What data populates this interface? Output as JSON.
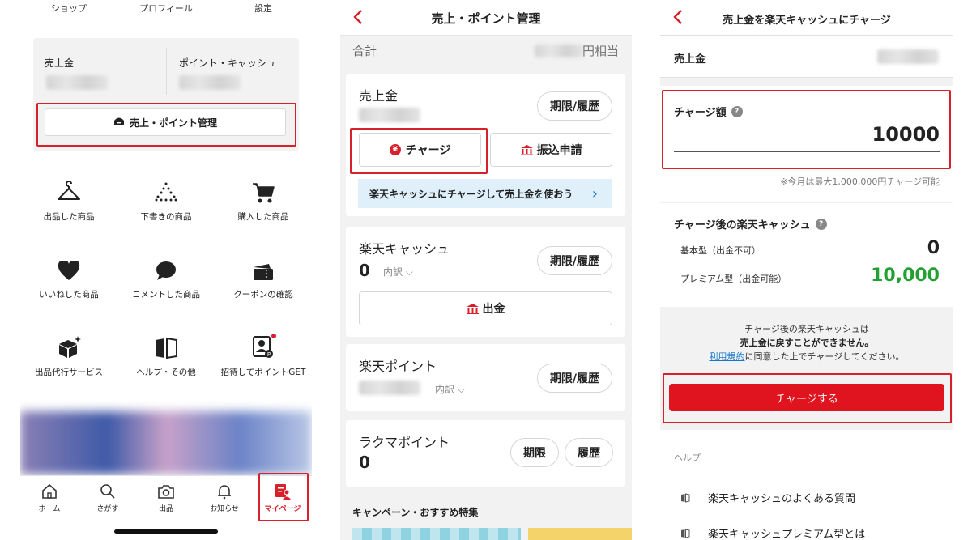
{
  "colors": {
    "accent": "#d8202b",
    "positive": "#22a032",
    "link": "#1677c9",
    "info_bg": "#dff0fb"
  },
  "panel1": {
    "top_nav": [
      "ショップ",
      "プロフィール",
      "設定"
    ],
    "sales_label": "売上金",
    "points_cash_label": "ポイント・キャッシュ",
    "manage_button": "売上・ポイント管理",
    "grid": [
      {
        "label": "出品した商品",
        "icon": "hanger-icon"
      },
      {
        "label": "下書きの商品",
        "icon": "dotted-hanger-icon"
      },
      {
        "label": "購入した商品",
        "icon": "cart-icon"
      },
      {
        "label": "いいねした商品",
        "icon": "heart-icon"
      },
      {
        "label": "コメントした商品",
        "icon": "comment-icon"
      },
      {
        "label": "クーポンの確認",
        "icon": "coupon-icon"
      },
      {
        "label": "出品代行サービス",
        "icon": "box-sparkle-icon"
      },
      {
        "label": "ヘルプ・その他",
        "icon": "book-icon"
      },
      {
        "label": "招待してポイントGET",
        "icon": "invite-icon"
      }
    ],
    "tabs": [
      {
        "label": "ホーム",
        "icon": "home-icon"
      },
      {
        "label": "さがす",
        "icon": "search-icon"
      },
      {
        "label": "出品",
        "icon": "camera-icon"
      },
      {
        "label": "お知らせ",
        "icon": "bell-icon"
      },
      {
        "label": "マイページ",
        "icon": "mypage-icon",
        "active": true
      }
    ]
  },
  "panel2": {
    "title": "売上・ポイント管理",
    "total_label": "合計",
    "total_suffix": "円相当",
    "sales_card": {
      "title": "売上金",
      "history_button": "期限/履歴",
      "charge_button": "チャージ",
      "transfer_button": "振込申請",
      "info_strip": "楽天キャッシュにチャージして売上金を使おう"
    },
    "cash_card": {
      "title": "楽天キャッシュ",
      "value": "0",
      "breakdown": "内訳",
      "history_button": "期限/履歴",
      "withdraw_button": "出金"
    },
    "points_card": {
      "title": "楽天ポイント",
      "breakdown": "内訳",
      "history_button": "期限/履歴"
    },
    "rakuma_card": {
      "title": "ラクマポイント",
      "value": "0",
      "expiry_button": "期限",
      "history_button": "履歴"
    },
    "campaign_title": "キャンペーン・おすすめ特集"
  },
  "panel3": {
    "title": "売上金を楽天キャッシュにチャージ",
    "sales_label": "売上金",
    "amount_label": "チャージ額",
    "amount_value": "10000",
    "amount_note": "※今月は最大1,000,000円チャージ可能",
    "after_label": "チャージ後の楽天キャッシュ",
    "basic_label": "基本型（出金不可）",
    "basic_value": "0",
    "premium_label": "プレミアム型（出金可能）",
    "premium_value": "10,000",
    "notice_line1": "チャージ後の楽天キャッシュは",
    "notice_line2": "売上金に戻すことができません。",
    "notice_link": "利用規約",
    "notice_line3": "に同意した上でチャージしてください。",
    "charge_button": "チャージする",
    "help_label": "ヘルプ",
    "help_items": [
      "楽天キャッシュのよくある質問",
      "楽天キャッシュプレミアム型とは"
    ]
  }
}
